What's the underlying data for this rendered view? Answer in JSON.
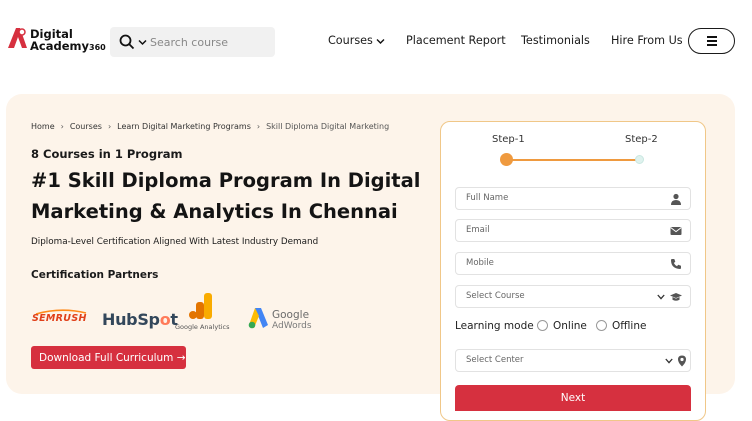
{
  "brand": {
    "line1": "Digital",
    "line2": "Academy",
    "suffix": "360"
  },
  "search": {
    "placeholder": "Search course"
  },
  "nav": {
    "courses": "Courses",
    "placement": "Placement Report",
    "testimonials": "Testimonials",
    "hire": "Hire From Us"
  },
  "breadcrumb": [
    "Home",
    "Courses",
    "Learn Digital Marketing Programs",
    "Skill Diploma Digital Marketing"
  ],
  "hero": {
    "subhead": "8 Courses in 1 Program",
    "title": "#1 Skill Diploma Program In Digital Marketing & Analytics In Chennai",
    "tagline": "Diploma-Level Certification Aligned With Latest Industry Demand",
    "partners_heading": "Certification Partners",
    "download_label": "Download Full Curriculum →"
  },
  "partners": {
    "semrush": "SEMRUSH",
    "hubspot_a": "HubSp",
    "hubspot_o": "o",
    "hubspot_b": "t",
    "google_analytics": "Google Analytics",
    "adwords_line1": "Google",
    "adwords_line2": "AdWords"
  },
  "form": {
    "step1": "Step-1",
    "step2": "Step-2",
    "full_name": "Full Name",
    "email": "Email",
    "mobile": "Mobile",
    "course": "Select Course",
    "learning_mode": "Learning mode",
    "online": "Online",
    "offline": "Offline",
    "center": "Select Center",
    "next": "Next"
  },
  "colors": {
    "accent": "#d6303f",
    "orange": "#ef9a3f",
    "hero_bg": "#fdf4ea"
  }
}
